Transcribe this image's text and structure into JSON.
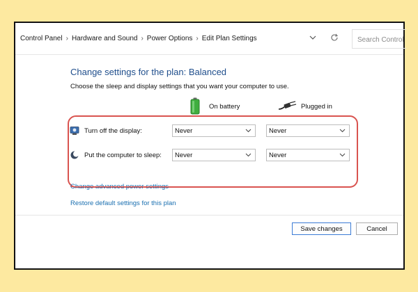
{
  "breadcrumb": {
    "items": [
      "Control Panel",
      "Hardware and Sound",
      "Power Options",
      "Edit Plan Settings"
    ],
    "separator": "›"
  },
  "search": {
    "placeholder": "Search Control"
  },
  "page": {
    "heading": "Change settings for the plan: Balanced",
    "subtitle": "Choose the sleep and display settings that you want your computer to use."
  },
  "columns": {
    "on_battery": "On battery",
    "plugged_in": "Plugged in"
  },
  "rows": [
    {
      "label": "Turn off the display:",
      "on_battery": "Never",
      "plugged_in": "Never"
    },
    {
      "label": "Put the computer to sleep:",
      "on_battery": "Never",
      "plugged_in": "Never"
    }
  ],
  "links": {
    "advanced": "Change advanced power settings",
    "restore": "Restore default settings for this plan"
  },
  "buttons": {
    "save": "Save changes",
    "cancel": "Cancel"
  },
  "colors": {
    "background": "#fde9a0",
    "heading": "#1f4e8c",
    "link": "#1a6fb0",
    "highlight": "#d9534f",
    "primary_border": "#3a7bd5"
  }
}
